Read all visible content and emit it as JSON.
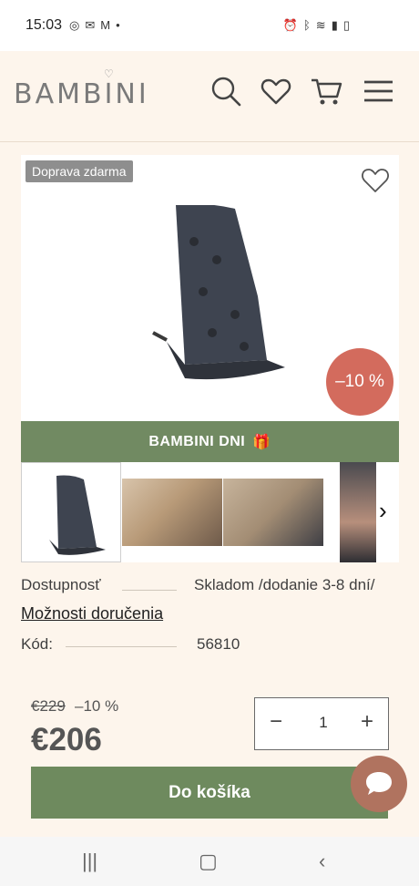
{
  "status_bar": {
    "time": "15:03",
    "left_icons": [
      "instagram-icon",
      "mail-icon",
      "gmail-icon",
      "dot"
    ],
    "right_icons": [
      "alarm-icon",
      "bluetooth-icon",
      "wifi-icon",
      "signal-icon",
      "battery-icon"
    ]
  },
  "header": {
    "logo": "BAMBINI",
    "icons": [
      "search-icon",
      "heart-icon",
      "cart-icon",
      "menu-icon"
    ]
  },
  "product": {
    "badge_free": "Doprava zdarma",
    "discount_badge": "–10 %",
    "promo_label": "BAMBINI DNI",
    "promo_icon": "🎁"
  },
  "details": {
    "availability_label": "Dostupnosť",
    "availability_value": "Skladom /dodanie 3-8 dní/",
    "delivery_link": "Možnosti doručenia",
    "code_label": "Kód:",
    "code_value": "56810"
  },
  "price": {
    "old": "€229",
    "percent": "–10 %",
    "new": "€206"
  },
  "quantity": {
    "minus": "−",
    "value": "1",
    "plus": "+"
  },
  "cart_button": "Do košíka",
  "colors": {
    "background": "#fdf5ec",
    "green": "#718a62",
    "discount": "#d36b5d",
    "chat": "#b0735f"
  }
}
